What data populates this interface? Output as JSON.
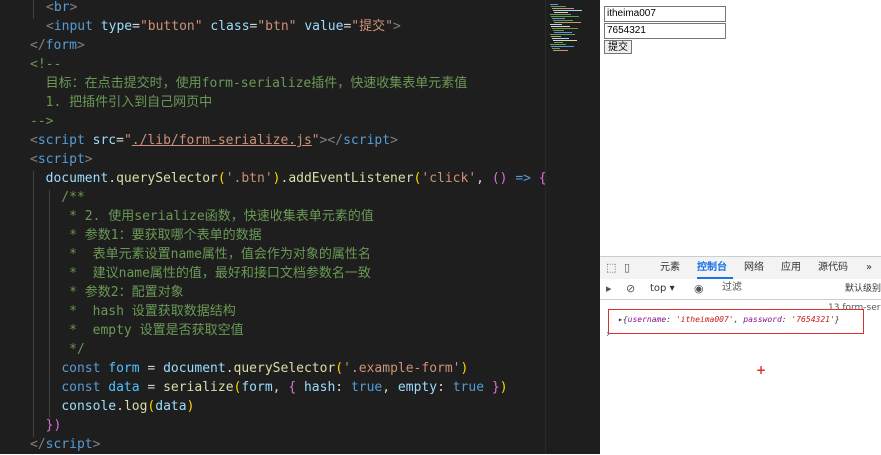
{
  "editor": {
    "lines": [
      {
        "segments": [
          {
            "t": "<",
            "c": "punct"
          },
          {
            "t": "br",
            "c": "tag"
          },
          {
            "t": ">",
            "c": "punct"
          }
        ]
      },
      {
        "segments": [
          {
            "t": "<",
            "c": "punct"
          },
          {
            "t": "input",
            "c": "tag"
          },
          {
            "t": " ",
            "c": ""
          },
          {
            "t": "type",
            "c": "attr"
          },
          {
            "t": "=",
            "c": ""
          },
          {
            "t": "\"button\"",
            "c": "str"
          },
          {
            "t": " ",
            "c": ""
          },
          {
            "t": "class",
            "c": "attr"
          },
          {
            "t": "=",
            "c": ""
          },
          {
            "t": "\"btn\"",
            "c": "str"
          },
          {
            "t": " ",
            "c": ""
          },
          {
            "t": "value",
            "c": "attr"
          },
          {
            "t": "=",
            "c": ""
          },
          {
            "t": "\"提交\"",
            "c": "str"
          },
          {
            "t": ">",
            "c": "punct"
          }
        ]
      },
      {
        "segments": [
          {
            "t": "</",
            "c": "punct"
          },
          {
            "t": "form",
            "c": "tag"
          },
          {
            "t": ">",
            "c": "punct"
          }
        ]
      },
      {
        "segments": [
          {
            "t": "<!--",
            "c": "cmt"
          }
        ]
      },
      {
        "segments": [
          {
            "t": "  目标：在点击提交时，使用form-serialize插件，快速收集表单元素值",
            "c": "cmt"
          }
        ]
      },
      {
        "segments": [
          {
            "t": "  1. 把插件引入到自己网页中",
            "c": "cmt"
          }
        ]
      },
      {
        "segments": [
          {
            "t": "-->",
            "c": "cmt"
          }
        ]
      },
      {
        "segments": [
          {
            "t": "<",
            "c": "punct"
          },
          {
            "t": "script",
            "c": "tag"
          },
          {
            "t": " ",
            "c": ""
          },
          {
            "t": "src",
            "c": "attr"
          },
          {
            "t": "=",
            "c": ""
          },
          {
            "t": "\"",
            "c": "str"
          },
          {
            "t": "./lib/form-serialize.js",
            "c": "str link"
          },
          {
            "t": "\"",
            "c": "str"
          },
          {
            "t": "></",
            "c": "punct"
          },
          {
            "t": "script",
            "c": "tag"
          },
          {
            "t": ">",
            "c": "punct"
          }
        ]
      },
      {
        "segments": [
          {
            "t": "<",
            "c": "punct"
          },
          {
            "t": "script",
            "c": "tag"
          },
          {
            "t": ">",
            "c": "punct"
          }
        ]
      },
      {
        "segments": [
          {
            "t": "  ",
            "c": ""
          },
          {
            "t": "document",
            "c": "attr"
          },
          {
            "t": ".",
            "c": ""
          },
          {
            "t": "querySelector",
            "c": "fn"
          },
          {
            "t": "(",
            "c": "brace"
          },
          {
            "t": "'.btn'",
            "c": "str"
          },
          {
            "t": ")",
            "c": "brace"
          },
          {
            "t": ".",
            "c": ""
          },
          {
            "t": "addEventListener",
            "c": "fn"
          },
          {
            "t": "(",
            "c": "brace"
          },
          {
            "t": "'click'",
            "c": "str"
          },
          {
            "t": ", ",
            "c": ""
          },
          {
            "t": "()",
            "c": "brace2"
          },
          {
            "t": " ",
            "c": ""
          },
          {
            "t": "=>",
            "c": "kw"
          },
          {
            "t": " ",
            "c": ""
          },
          {
            "t": "{",
            "c": "brace2"
          }
        ]
      },
      {
        "segments": [
          {
            "t": "    /**",
            "c": "cmt"
          }
        ]
      },
      {
        "segments": [
          {
            "t": "     * 2. 使用serialize函数，快速收集表单元素的值",
            "c": "cmt"
          }
        ]
      },
      {
        "segments": [
          {
            "t": "     * 参数1：要获取哪个表单的数据",
            "c": "cmt"
          }
        ]
      },
      {
        "segments": [
          {
            "t": "     *  表单元素设置name属性，值会作为对象的属性名",
            "c": "cmt"
          }
        ]
      },
      {
        "segments": [
          {
            "t": "     *  建议name属性的值，最好和接口文档参数名一致",
            "c": "cmt"
          }
        ]
      },
      {
        "segments": [
          {
            "t": "     * 参数2：配置对象",
            "c": "cmt"
          }
        ]
      },
      {
        "segments": [
          {
            "t": "     *  hash 设置获取数据结构",
            "c": "cmt"
          }
        ]
      },
      {
        "segments": [
          {
            "t": "     *  empty 设置是否获取空值",
            "c": "cmt"
          }
        ]
      },
      {
        "segments": [
          {
            "t": "     */",
            "c": "cmt"
          }
        ]
      },
      {
        "segments": [
          {
            "t": "    ",
            "c": ""
          },
          {
            "t": "const",
            "c": "kw"
          },
          {
            "t": " ",
            "c": ""
          },
          {
            "t": "form",
            "c": "var"
          },
          {
            "t": " = ",
            "c": ""
          },
          {
            "t": "document",
            "c": "attr"
          },
          {
            "t": ".",
            "c": ""
          },
          {
            "t": "querySelector",
            "c": "fn"
          },
          {
            "t": "(",
            "c": "brace"
          },
          {
            "t": "'.example-form'",
            "c": "str"
          },
          {
            "t": ")",
            "c": "brace"
          }
        ]
      },
      {
        "segments": [
          {
            "t": "    ",
            "c": ""
          },
          {
            "t": "const",
            "c": "kw"
          },
          {
            "t": " ",
            "c": ""
          },
          {
            "t": "data",
            "c": "var"
          },
          {
            "t": " = ",
            "c": ""
          },
          {
            "t": "serialize",
            "c": "fn"
          },
          {
            "t": "(",
            "c": "brace"
          },
          {
            "t": "form",
            "c": "attr"
          },
          {
            "t": ", ",
            "c": ""
          },
          {
            "t": "{",
            "c": "brace2"
          },
          {
            "t": " ",
            "c": ""
          },
          {
            "t": "hash",
            "c": "attr"
          },
          {
            "t": ": ",
            "c": ""
          },
          {
            "t": "true",
            "c": "kw"
          },
          {
            "t": ", ",
            "c": ""
          },
          {
            "t": "empty",
            "c": "attr"
          },
          {
            "t": ": ",
            "c": ""
          },
          {
            "t": "true",
            "c": "kw"
          },
          {
            "t": " ",
            "c": ""
          },
          {
            "t": "}",
            "c": "brace2"
          },
          {
            "t": ")",
            "c": "brace"
          }
        ]
      },
      {
        "segments": [
          {
            "t": "    ",
            "c": ""
          },
          {
            "t": "console",
            "c": "attr"
          },
          {
            "t": ".",
            "c": ""
          },
          {
            "t": "log",
            "c": "fn"
          },
          {
            "t": "(",
            "c": "brace"
          },
          {
            "t": "data",
            "c": "attr"
          },
          {
            "t": ")",
            "c": "brace"
          }
        ]
      },
      {
        "segments": [
          {
            "t": "  ",
            "c": ""
          },
          {
            "t": "})",
            "c": "brace2"
          }
        ]
      },
      {
        "segments": [
          {
            "t": "</",
            "c": "punct"
          },
          {
            "t": "script",
            "c": "tag"
          },
          {
            "t": ">",
            "c": "punct"
          }
        ]
      }
    ]
  },
  "preview": {
    "username_value": "itheima007",
    "password_value": "7654321",
    "submit_label": "提交"
  },
  "devtools": {
    "tabs": [
      "元素",
      "控制台",
      "网络",
      "应用",
      "源代码"
    ],
    "active_tab": "控制台",
    "more": "»",
    "context": "top ▾",
    "filter_placeholder": "过滤",
    "level": "默认级别",
    "source_link": "13.form-ser",
    "log_prefix": "▸{",
    "log_key1": "username",
    "log_val1": "'itheima007'",
    "log_key2": "password",
    "log_val2": "'7654321'",
    "log_suffix": "}",
    "prompt": "›"
  }
}
